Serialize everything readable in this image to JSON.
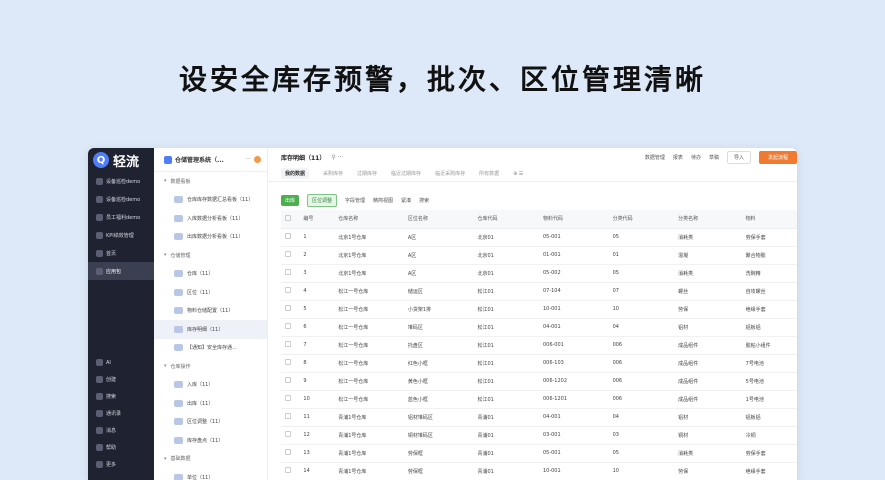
{
  "headline": "设安全库存预警，批次、区位管理清晰",
  "nav": {
    "logo_letter": "Q",
    "logo_text": "轻流",
    "items": [
      {
        "label": "设备巡检demo",
        "active": false
      },
      {
        "label": "设备巡检demo",
        "active": false
      },
      {
        "label": "员工福利demo",
        "active": false
      },
      {
        "label": "KPI绩效管理",
        "active": false
      },
      {
        "label": "首页",
        "active": false
      },
      {
        "label": "应用包",
        "active": true
      }
    ],
    "bottom": [
      {
        "label": "AI"
      },
      {
        "label": "创建"
      },
      {
        "label": "搜索"
      },
      {
        "label": "通讯录"
      },
      {
        "label": "消息"
      },
      {
        "label": "帮助"
      },
      {
        "label": "更多"
      }
    ]
  },
  "tree": {
    "app_title": "仓储管理系统（...",
    "dots": "···",
    "groups": [
      {
        "label": "数据看板",
        "leaves": [
          "仓库库存数据汇总看板（11）",
          "入库数据分析看板（11）",
          "出库数据分析看板（11）"
        ]
      },
      {
        "label": "仓储管理",
        "leaves": [
          "仓库（11）",
          "区位（11）",
          "物料仓储配置（11）",
          "库存明细（11）",
          "【通知】安全库存通..."
        ]
      },
      {
        "label": "仓库操作",
        "leaves": [
          "入库（11）",
          "出库（11）",
          "区位调整（11）",
          "库存盘点（11）"
        ]
      },
      {
        "label": "基础数据",
        "leaves": [
          "单位（11）"
        ]
      }
    ],
    "selected_leaf": "库存明细（11）"
  },
  "main": {
    "title": "库存明细（11）",
    "title_icons": "⚲ ···",
    "top_actions": [
      "数据管理",
      "报表",
      "待办",
      "草稿"
    ],
    "import_label": "导入",
    "publish_label": "发起流程",
    "tabs": [
      "我的数据",
      "采购库存",
      "过期库存",
      "临近过期库存",
      "临近采购库存",
      "所有数据"
    ],
    "tab_extra": "⊕ ☰",
    "toolbar": {
      "out_label": "出库",
      "adjust_label": "区位调整",
      "items": [
        "字段管理",
        "精简视图",
        "紧凑",
        "搜索"
      ]
    },
    "columns": [
      "编号",
      "仓库名称",
      "区位名称",
      "仓库代码",
      "物料代码",
      "分类代码",
      "分类名称",
      "物料"
    ],
    "rows": [
      [
        "1",
        "北京1号仓库",
        "A区",
        "北京01",
        "05-001",
        "05",
        "消耗类",
        "劳保手套"
      ],
      [
        "2",
        "北京1号仓库",
        "A区",
        "北京01",
        "01-001",
        "01",
        "混凝",
        "聚合物胶"
      ],
      [
        "3",
        "北京1号仓库",
        "A区",
        "北京01",
        "05-002",
        "05",
        "消耗类",
        "洗碗精"
      ],
      [
        "4",
        "松江一号仓库",
        "储运区",
        "松江01",
        "07-104",
        "07",
        "螺丝",
        "自攻螺丝"
      ],
      [
        "5",
        "松江一号仓库",
        "小货架1排",
        "松江01",
        "10-001",
        "10",
        "劳保",
        "绝缘手套"
      ],
      [
        "6",
        "松江一号仓库",
        "堆码区",
        "松江01",
        "04-001",
        "04",
        "铝材",
        "铝板铝"
      ],
      [
        "7",
        "松江一号仓库",
        "托盘区",
        "松江01",
        "006-001",
        "006",
        "成品组件",
        "胶粘小组件"
      ],
      [
        "8",
        "松江一号仓库",
        "红色小框",
        "松江01",
        "006-103",
        "006",
        "成品组件",
        "7号电池"
      ],
      [
        "9",
        "松江一号仓库",
        "黄色小框",
        "松江01",
        "006-1202",
        "006",
        "成品组件",
        "5号电池"
      ],
      [
        "10",
        "松江一号仓库",
        "蓝色小框",
        "松江01",
        "006-1201",
        "006",
        "成品组件",
        "1号电池"
      ],
      [
        "11",
        "青浦1号仓库",
        "铝材堆码区",
        "青浦01",
        "04-001",
        "04",
        "铝材",
        "铝板铝"
      ],
      [
        "12",
        "青浦1号仓库",
        "铜材堆码区",
        "青浦01",
        "03-001",
        "03",
        "铜材",
        "冷铜"
      ],
      [
        "13",
        "青浦1号仓库",
        "劳保框",
        "青浦01",
        "05-001",
        "05",
        "消耗类",
        "劳保手套"
      ],
      [
        "14",
        "青浦1号仓库",
        "劳保框",
        "青浦01",
        "10-001",
        "10",
        "劳保",
        "绝缘手套"
      ]
    ]
  }
}
